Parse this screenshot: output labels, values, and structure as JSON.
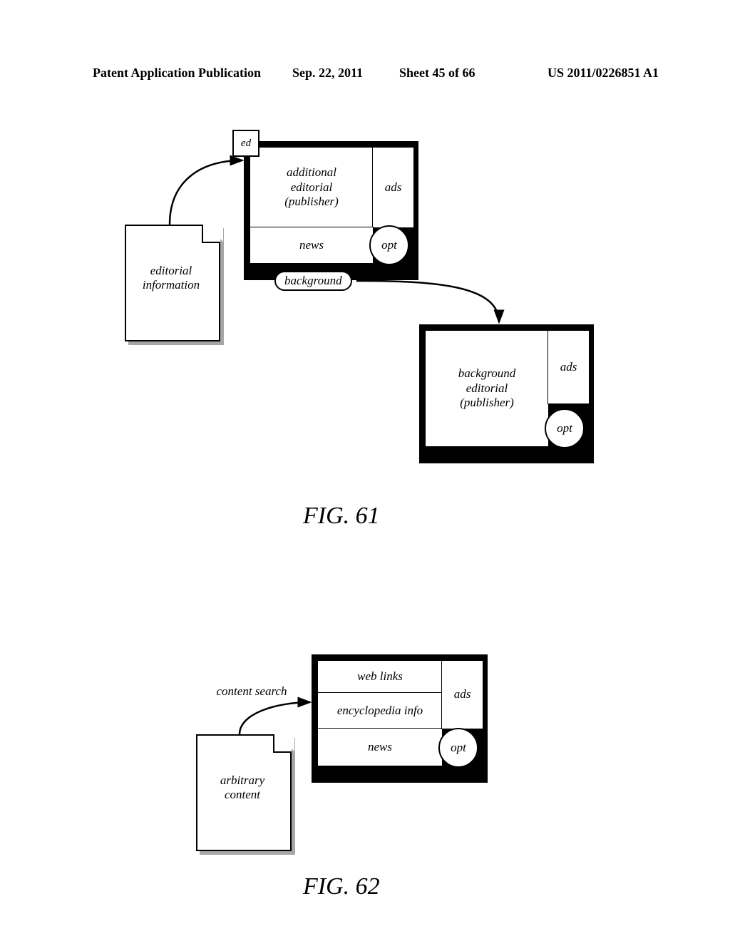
{
  "header": {
    "pub": "Patent Application Publication",
    "date": "Sep. 22, 2011",
    "sheet": "Sheet 45 of 66",
    "docnum": "US 2011/0226851 A1"
  },
  "fig61": {
    "caption": "FIG. 61",
    "doc_text": "editorial\ninformation",
    "ed_box": "ed",
    "panel1_main": "additional\neditorial\n(publisher)",
    "panel1_news": "news",
    "panel1_ads": "ads",
    "panel1_opt": "opt",
    "background_tab": "background",
    "panel2_main": "background\neditorial\n(publisher)",
    "panel2_ads": "ads",
    "panel2_opt": "opt"
  },
  "fig62": {
    "caption": "FIG. 62",
    "doc_text": "arbitrary\ncontent",
    "search_label": "content search",
    "cell_weblinks": "web links",
    "cell_encyclopedia": "encyclopedia info",
    "cell_news": "news",
    "cell_ads": "ads",
    "cell_opt": "opt"
  }
}
